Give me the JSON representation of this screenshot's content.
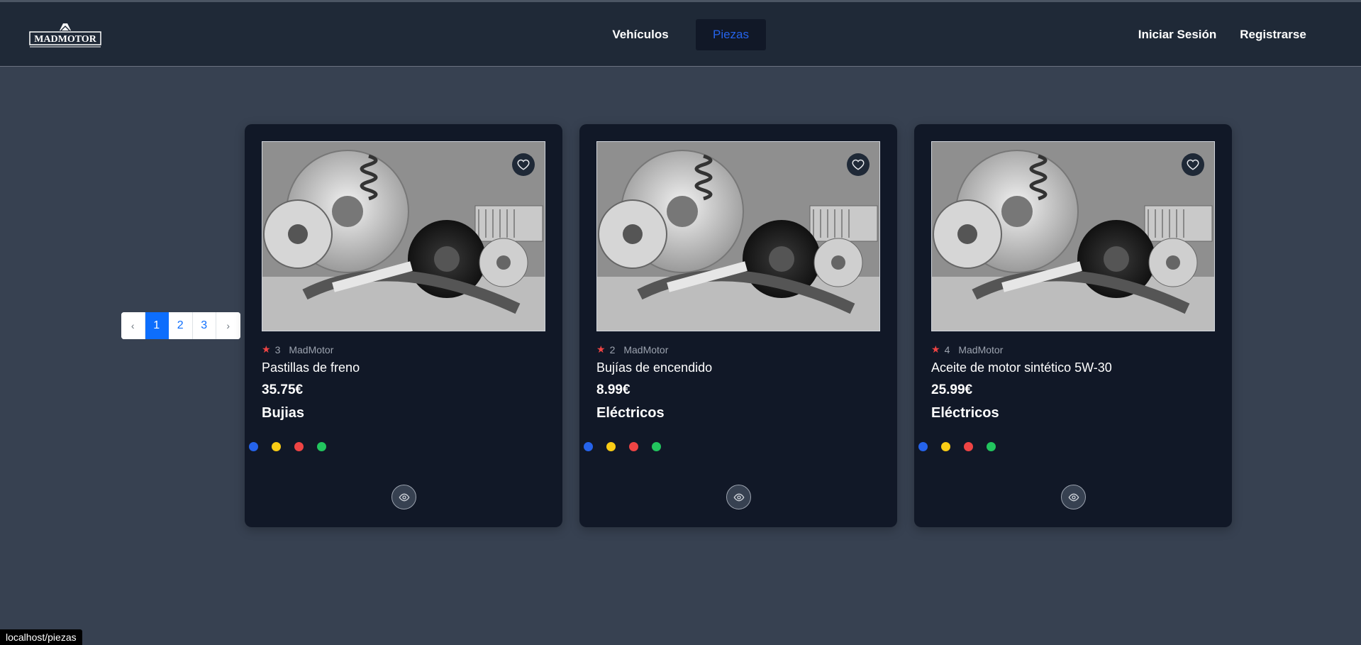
{
  "header": {
    "logo_text": "MADMOTOR",
    "nav": [
      {
        "label": "Vehículos",
        "active": false
      },
      {
        "label": "Piezas",
        "active": true
      }
    ],
    "login_label": "Iniciar Sesión",
    "register_label": "Registrarse"
  },
  "pagination": {
    "prev": "‹",
    "pages": [
      "1",
      "2",
      "3"
    ],
    "active_page": "1",
    "next": "›"
  },
  "products": [
    {
      "rating": "3",
      "brand": "MadMotor",
      "name": "Pastillas de freno",
      "price": "35.75€",
      "category": "Bujias"
    },
    {
      "rating": "2",
      "brand": "MadMotor",
      "name": "Bujías de encendido",
      "price": "8.99€",
      "category": "Eléctricos"
    },
    {
      "rating": "4",
      "brand": "MadMotor",
      "name": "Aceite de motor sintético 5W-30",
      "price": "25.99€",
      "category": "Eléctricos"
    }
  ],
  "product_icons": {
    "favorite": "heart-icon",
    "view": "eye-icon",
    "rating": "star-icon"
  },
  "color_options": [
    "#2563eb",
    "#facc15",
    "#ef4444",
    "#22c55e"
  ],
  "status_bar": {
    "url": "localhost/piezas"
  }
}
